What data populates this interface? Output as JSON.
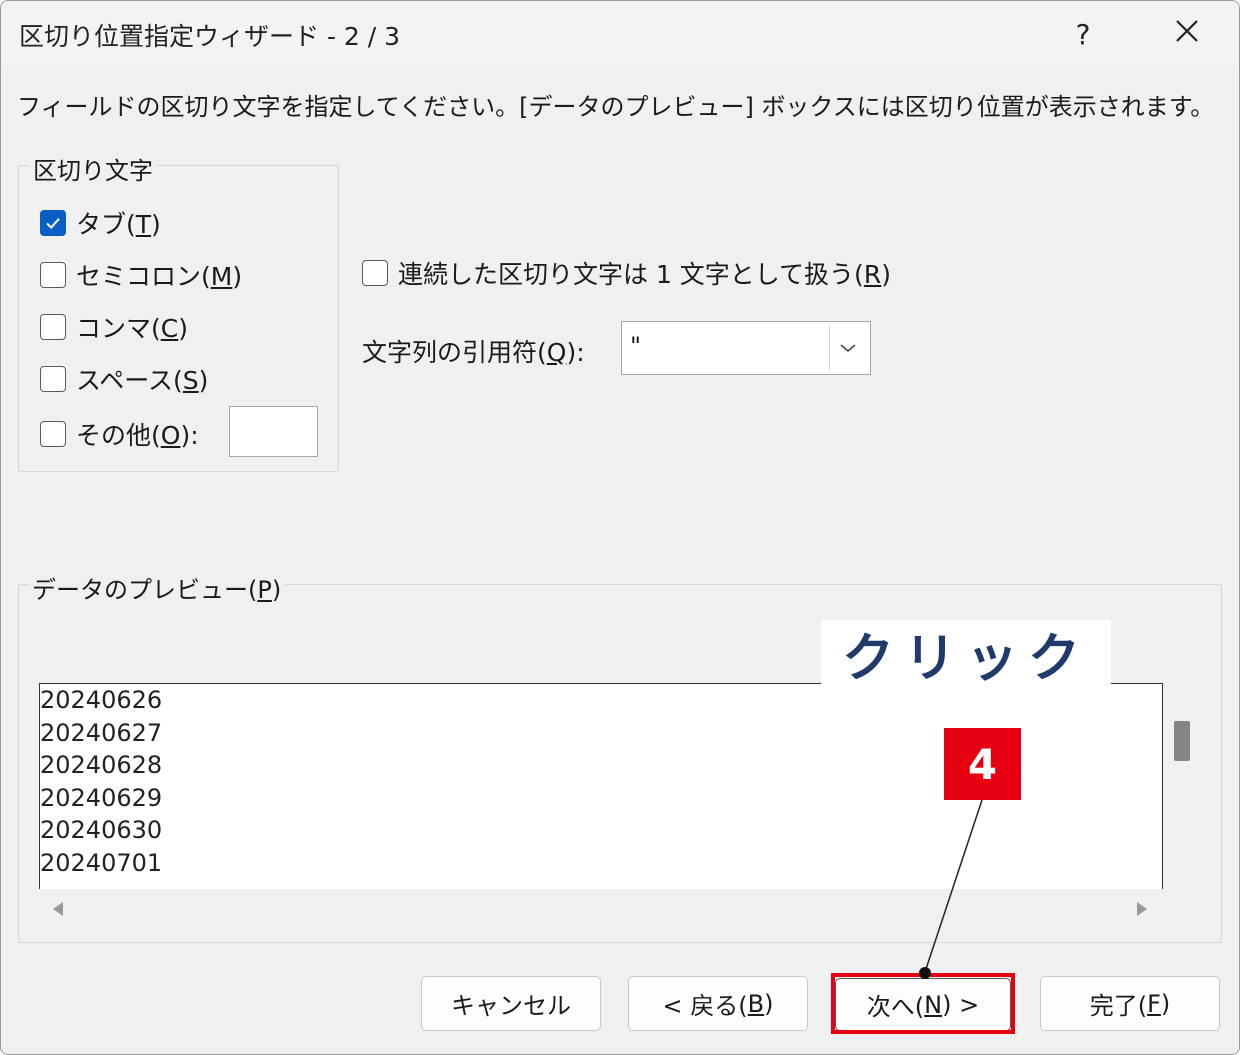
{
  "window": {
    "title": "区切り位置指定ウィザード - 2 / 3",
    "help_label": "?",
    "close_label": "✕"
  },
  "instruction": "フィールドの区切り文字を指定してください。[データのプレビュー] ボックスには区切り位置が表示されます。",
  "delimiters": {
    "legend": "区切り文字",
    "options": [
      {
        "label": "タブ(",
        "key": "T",
        "suffix": ")",
        "checked": true
      },
      {
        "label": "セミコロン(",
        "key": "M",
        "suffix": ")",
        "checked": false
      },
      {
        "label": "コンマ(",
        "key": "C",
        "suffix": ")",
        "checked": false
      },
      {
        "label": "スペース(",
        "key": "S",
        "suffix": ")",
        "checked": false
      },
      {
        "label": "その他(",
        "key": "O",
        "suffix": "):",
        "checked": false
      }
    ],
    "other_value": ""
  },
  "consecutive": {
    "label": "連続した区切り文字は 1 文字として扱う(",
    "key": "R",
    "suffix": ")",
    "checked": false
  },
  "text_qualifier": {
    "label": "文字列の引用符(",
    "key": "Q",
    "suffix": "):",
    "value": "\""
  },
  "preview": {
    "legend": "データのプレビュー(",
    "key": "P",
    "suffix": ")",
    "lines": [
      "20240626",
      "20240627",
      "20240628",
      "20240629",
      "20240630",
      "20240701"
    ]
  },
  "buttons": {
    "cancel": "キャンセル",
    "back": {
      "prefix": "< 戻る(",
      "key": "B",
      "suffix": ")"
    },
    "next": {
      "prefix": "次へ(",
      "key": "N",
      "suffix": ") >"
    },
    "finish": {
      "prefix": "完了(",
      "key": "F",
      "suffix": ")"
    }
  },
  "annotation": {
    "callout_text": "クリック",
    "step_number": "4",
    "highlight_color": "#e60012",
    "callout_text_color": "#1f3a6b"
  },
  "colors": {
    "dialog_bg": "#f0f0f0",
    "checkbox_checked": "#0a5fc4"
  }
}
